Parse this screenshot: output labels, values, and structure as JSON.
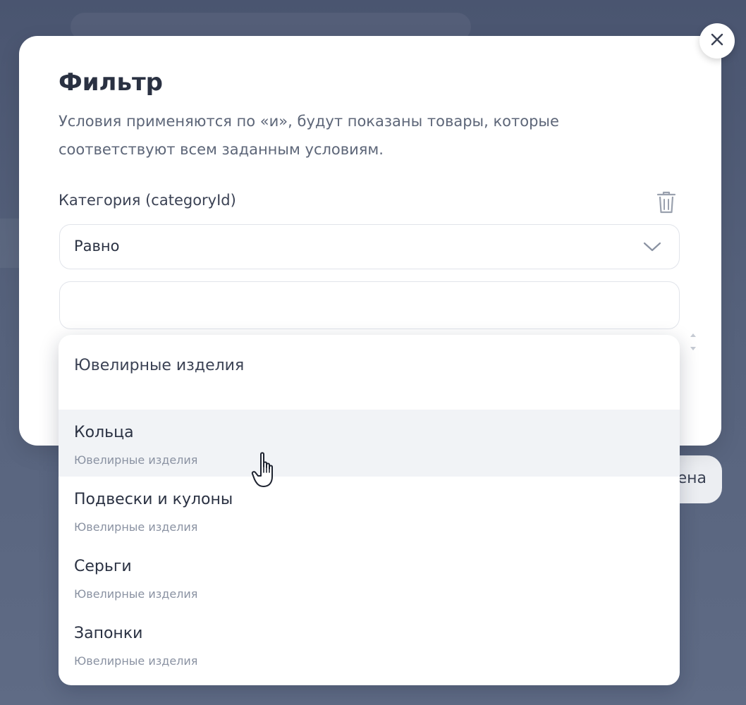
{
  "background": {
    "cancel_label_fragment": "ена"
  },
  "modal": {
    "title": "Фильтр",
    "description_line1": "Условия применяются по «и», будут показаны товары, которые",
    "description_line2": "соответствуют всем заданным условиям.",
    "close_icon": "close-icon",
    "condition": {
      "label": "Категория (categoryId)",
      "delete_icon": "trash-icon",
      "operator_value": "Равно",
      "operator_icon": "chevron-down-icon",
      "value_input": "",
      "value_placeholder": ""
    }
  },
  "dropdown": {
    "group_header": "Ювелирные изделия",
    "items": [
      {
        "name": "Кольца",
        "parent": "Ювелирные изделия",
        "hovered": true
      },
      {
        "name": "Подвески и кулоны",
        "parent": "Ювелирные изделия",
        "hovered": false
      },
      {
        "name": "Серьги",
        "parent": "Ювелирные изделия",
        "hovered": false
      },
      {
        "name": "Запонки",
        "parent": "Ювелирные изделия",
        "hovered": false
      }
    ]
  },
  "colors": {
    "overlay": "#56627c",
    "text_primary": "#2a3142",
    "text_secondary": "#5d6678",
    "hover": "#f1f3f6"
  }
}
